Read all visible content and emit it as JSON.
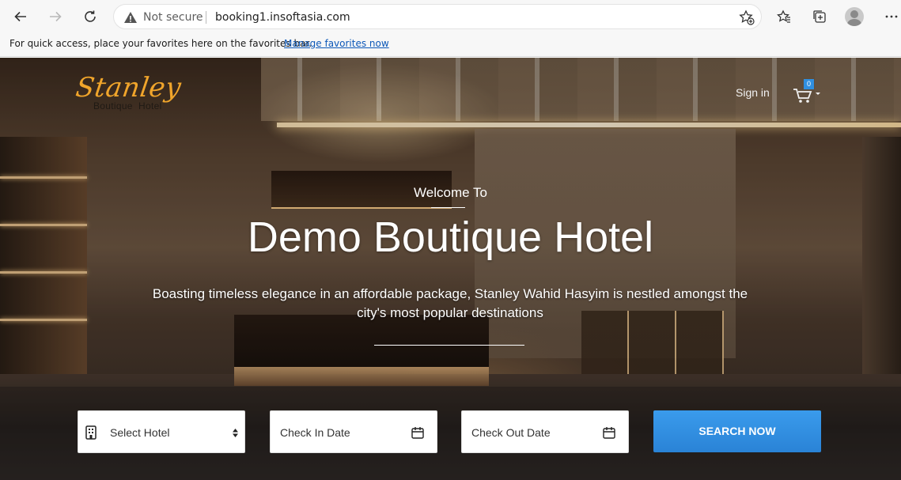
{
  "browser": {
    "security_label": "Not secure",
    "url": "booking1.insoftasia.com",
    "favbar_message": "For quick access, place your favorites here on the favorites bar.",
    "favbar_link": "Manage favorites now",
    "icons": [
      "back-icon",
      "forward-icon",
      "refresh-icon",
      "warning-icon",
      "add-favorite-icon",
      "favorites-icon",
      "collections-icon",
      "profile-avatar",
      "more-icon"
    ]
  },
  "site": {
    "logo_script": "Stanley",
    "logo_sub": "Boutique  Hotel",
    "signin": "Sign in",
    "cart_count": "0"
  },
  "hero": {
    "welcome": "Welcome To",
    "title": "Demo Boutique Hotel",
    "description": "Boasting timeless elegance in an affordable package, Stanley Wahid Hasyim is nestled amongst the city's most popular destinations"
  },
  "search_form": {
    "hotel_placeholder": "Select Hotel",
    "checkin_placeholder": "Check In Date",
    "checkout_placeholder": "Check Out Date",
    "button_label": "SEARCH NOW"
  },
  "colors": {
    "accent": "#2f8fe0",
    "logo": "#f0a52b"
  }
}
